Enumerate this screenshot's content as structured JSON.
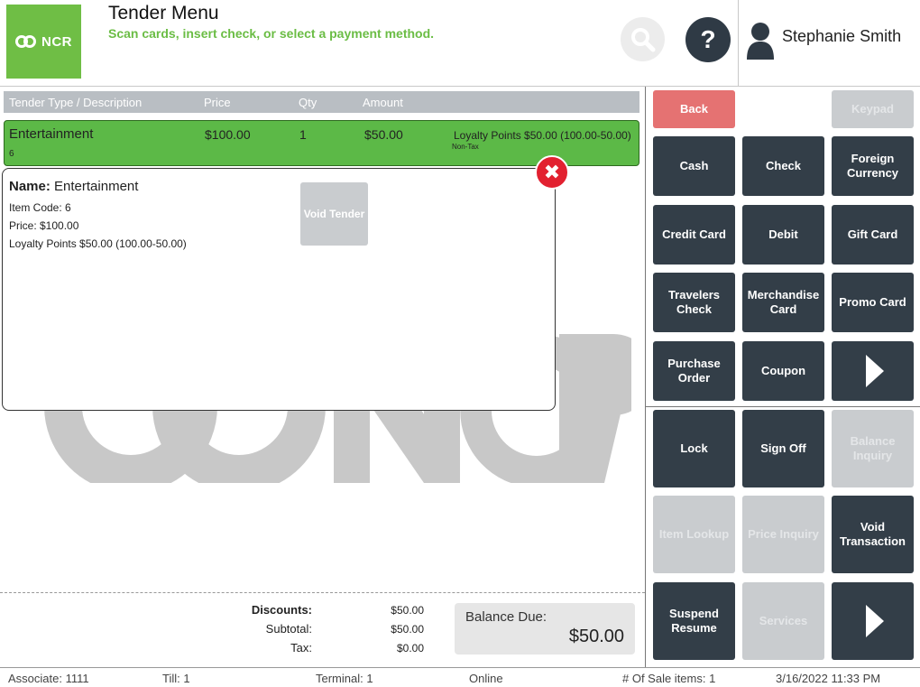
{
  "header": {
    "logo_text": "NCR",
    "title": "Tender Menu",
    "subtitle": "Scan cards, insert check, or select a payment method.",
    "help_label": "?",
    "user_name": "Stephanie Smith",
    "accent_color": "#6bbd45"
  },
  "table": {
    "columns": [
      "Tender Type / Description",
      "Price",
      "Qty",
      "Amount"
    ],
    "selected_row": {
      "description": "Entertainment",
      "code": "6",
      "price": "$100.00",
      "qty": "1",
      "amount": "$50.00",
      "note": "Loyalty Points $50.00 (100.00-50.00)",
      "tax_status": "Non-Tax"
    }
  },
  "detail": {
    "name_label": "Name:",
    "name_value": "Entertainment",
    "item_code": "Item Code: 6",
    "price": "Price: $100.00",
    "loyalty": "Loyalty Points $50.00 (100.00-50.00)",
    "void_label": "Void Tender",
    "close_label": "✖"
  },
  "totals": {
    "discounts_label": "Discounts:",
    "discounts_value": "$50.00",
    "subtotal_label": "Subtotal:",
    "subtotal_value": "$50.00",
    "tax_label": "Tax:",
    "tax_value": "$0.00",
    "balance_label": "Balance Due:",
    "balance_value": "$50.00"
  },
  "buttons": {
    "back": "Back",
    "keypad": "Keypad",
    "cash": "Cash",
    "check": "Check",
    "foreign_currency": "Foreign Currency",
    "credit_card": "Credit Card",
    "debit": "Debit",
    "gift_card": "Gift Card",
    "travelers_check": "Travelers Check",
    "merchandise_card": "Merchandise Card",
    "promo_card": "Promo Card",
    "purchase_order": "Purchase Order",
    "coupon": "Coupon",
    "lock": "Lock",
    "sign_off": "Sign Off",
    "balance_inquiry": "Balance Inquiry",
    "item_lookup": "Item Lookup",
    "price_inquiry": "Price Inquiry",
    "void_transaction": "Void Transaction",
    "suspend_resume": "Suspend Resume",
    "services": "Services"
  },
  "status": {
    "associate": "Associate: 1111",
    "till": "Till: 1",
    "terminal": "Terminal: 1",
    "online": "Online",
    "sale_items": "# Of Sale items: 1",
    "datetime": "3/16/2022 11:33 PM"
  }
}
